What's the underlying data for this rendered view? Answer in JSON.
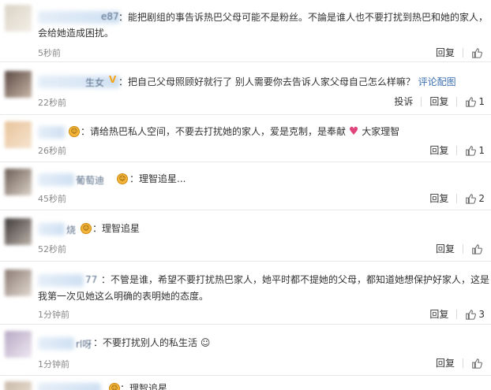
{
  "comments": [
    {
      "name_tail": "e87",
      "text_lines": [
        "：能把剧组的事告诉热巴父母可能不是粉丝。不論是谁人也不要打扰到热巴和她的家人，",
        "会给她造成困扰。"
      ],
      "time": "5秒前",
      "reply_label": "回复",
      "like_count": ""
    },
    {
      "name_tail": "生女",
      "text_lines": [
        "：把自己父母照顾好就行了 别人需要你去告诉人家父母自己怎么样嘛？"
      ],
      "link_text": "评论配图",
      "time": "22秒前",
      "report_label": "投诉",
      "reply_label": "回复",
      "like_count": "1"
    },
    {
      "name_tail": "",
      "text_lines": [
        "：请给热巴私人空间，不要去打扰她的家人，爱是克制，是奉献",
        "大家理智"
      ],
      "time": "26秒前",
      "reply_label": "回复",
      "like_count": "1"
    },
    {
      "name_tail": "葡萄迪",
      "text_lines": [
        "：理智追星..."
      ],
      "time": "45秒前",
      "reply_label": "回复",
      "like_count": "2"
    },
    {
      "name_tail": "烧",
      "text_lines": [
        "：理智追星"
      ],
      "time": "52秒前",
      "reply_label": "回复",
      "like_count": ""
    },
    {
      "name_tail": "77",
      "text_lines": [
        "：不管是谁，希望不要打扰热巴家人，她平时都不提她的父母，都知道她想保护好家人，这是",
        "我第一次见她这么明确的表明她的态度。"
      ],
      "time": "1分钟前",
      "reply_label": "回复",
      "like_count": "3"
    },
    {
      "name_tail": "rl呀",
      "text_lines": [
        "：不要打扰别人的私生活"
      ],
      "time": "1分钟前",
      "reply_label": "回复",
      "like_count": ""
    },
    {
      "name_tail": "",
      "text_lines": [
        "：理智追星"
      ],
      "time": "",
      "reply_label": "",
      "like_count": ""
    }
  ],
  "colors": {
    "link": "#3c6fb0",
    "divider": "#e8e8e8",
    "meta": "#888888"
  }
}
